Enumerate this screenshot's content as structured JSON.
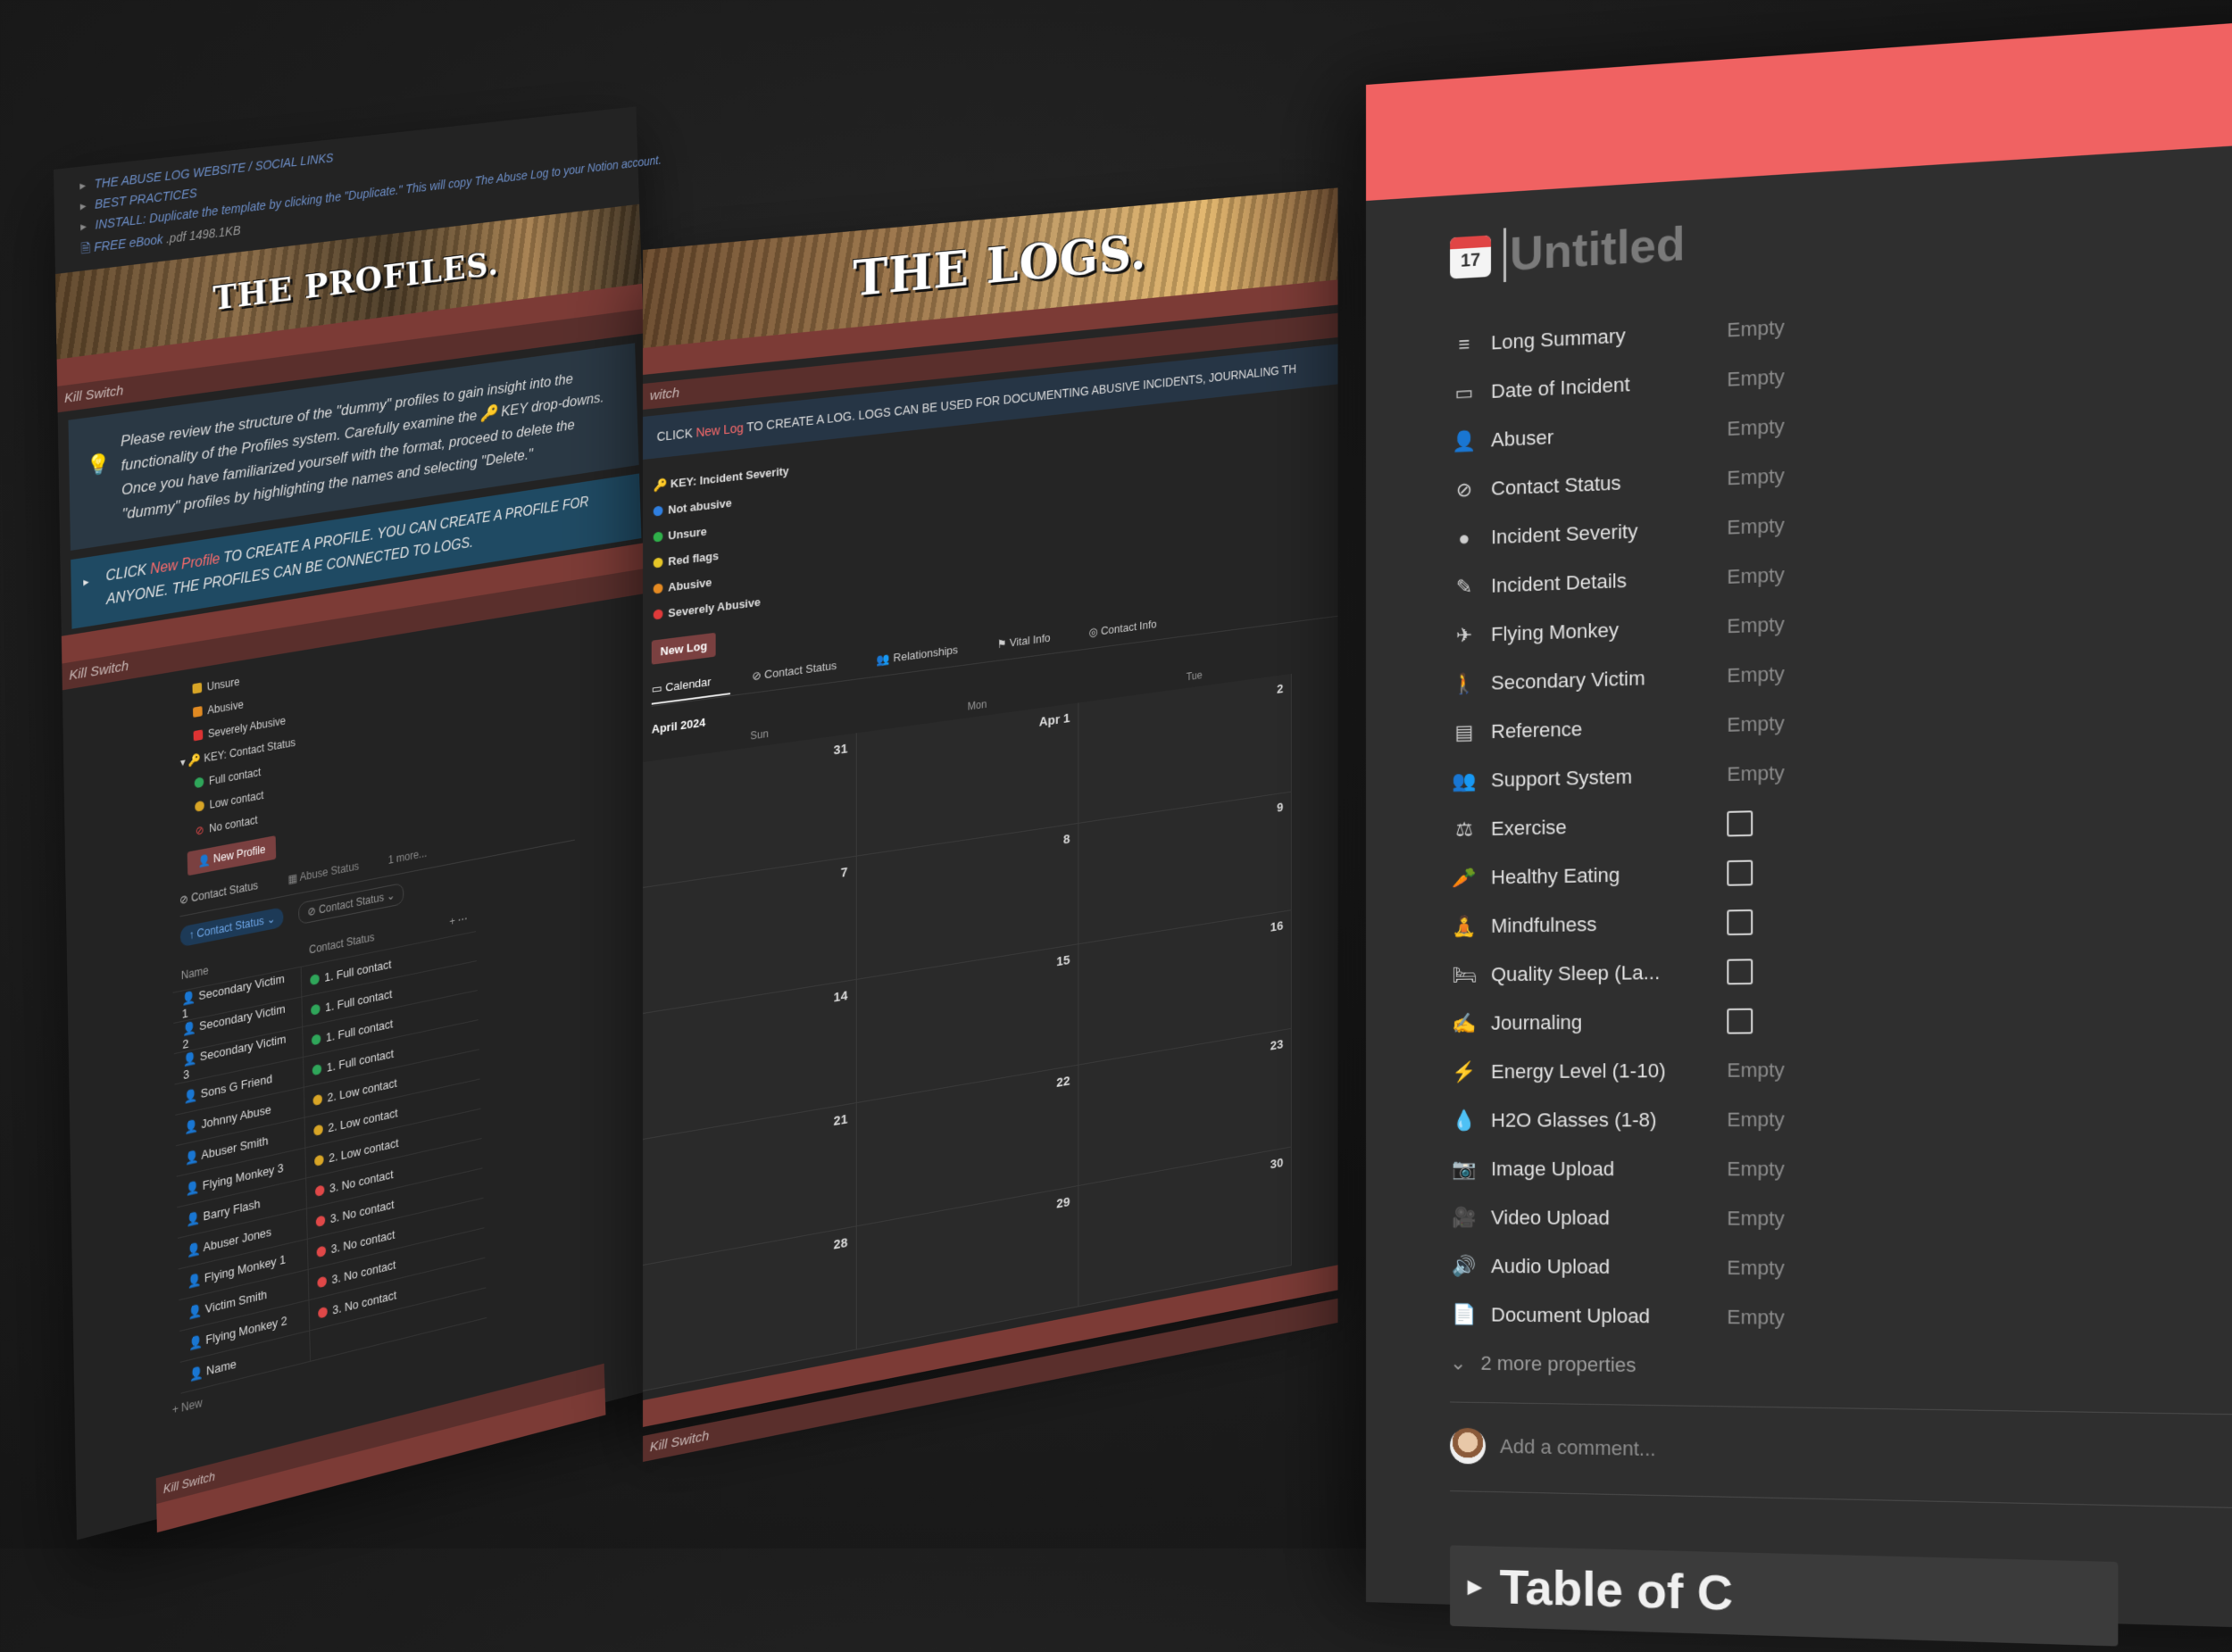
{
  "profiles": {
    "links": [
      "THE ABUSE LOG WEBSITE / SOCIAL LINKS",
      "BEST PRACTICES",
      "INSTALL: Duplicate the template by clicking the \"Duplicate.\" This will copy The Abuse Log to your Notion account."
    ],
    "ebook": "FREE eBook",
    "ebook_meta": ".pdf 1498.1KB",
    "banner_title": "THE PROFILES.",
    "kill_switch": "Kill Switch",
    "callout": "Please review the structure of the \"dummy\" profiles to gain insight into the functionality of the Profiles system. Carefully examine the 🔑 KEY drop-downs. Once you have familiarized yourself with the format, proceed to delete the \"dummy\" profiles by highlighting the names and selecting \"Delete.\"",
    "click_pre": "CLICK ",
    "click_link": "New Profile",
    "click_post": " TO CREATE A PROFILE. YOU CAN CREATE A PROFILE FOR ANYONE. THE PROFILES CAN BE CONNECTED TO LOGS.",
    "key_abuse": [
      "Unsure",
      "Abusive",
      "Severely Abusive"
    ],
    "key_contact_title": "KEY: Contact Status",
    "key_contact": [
      "Full contact",
      "Low contact",
      "No contact"
    ],
    "new_profile_btn": "New Profile",
    "tabs": [
      "Contact Status",
      "Abuse Status",
      "1 more..."
    ],
    "filter_chips": [
      "Contact Status",
      "Contact Status"
    ],
    "col_name": "Name",
    "col_status": "Contact Status",
    "rows": [
      {
        "name": "Secondary Victim 1",
        "status": "1. Full contact",
        "color": "#2fa65a"
      },
      {
        "name": "Secondary Victim 2",
        "status": "1. Full contact",
        "color": "#2fa65a"
      },
      {
        "name": "Secondary Victim 3",
        "status": "1. Full contact",
        "color": "#2fa65a"
      },
      {
        "name": "Sons G Friend",
        "status": "1. Full contact",
        "color": "#2fa65a"
      },
      {
        "name": "Johnny Abuse",
        "status": "2. Low contact",
        "color": "#d8a526"
      },
      {
        "name": "Abuser Smith",
        "status": "2. Low contact",
        "color": "#d8a526"
      },
      {
        "name": "Flying Monkey 3",
        "status": "2. Low contact",
        "color": "#d8a526"
      },
      {
        "name": "Barry Flash",
        "status": "3. No contact",
        "color": "#e04848"
      },
      {
        "name": "Abuser Jones",
        "status": "3. No contact",
        "color": "#e04848"
      },
      {
        "name": "Flying Monkey 1",
        "status": "3. No contact",
        "color": "#e04848"
      },
      {
        "name": "Victim Smith",
        "status": "3. No contact",
        "color": "#e04848"
      },
      {
        "name": "Flying Monkey 2",
        "status": "3. No contact",
        "color": "#e04848"
      },
      {
        "name": "Name",
        "status": "",
        "color": ""
      }
    ],
    "new_row": "+ New"
  },
  "logs": {
    "banner_title": "THE LOGS.",
    "switch_label": "witch",
    "click_pre": "CLICK ",
    "click_link": "New Log",
    "click_post": " TO CREATE A LOG. LOGS CAN BE USED FOR DOCUMENTING ABUSIVE INCIDENTS, JOURNALING TH",
    "key_title": "KEY: Incident Severity",
    "severity": [
      {
        "label": "Not abusive",
        "color": "#2f7fe0"
      },
      {
        "label": "Unsure",
        "color": "#2fb04a"
      },
      {
        "label": "Red flags",
        "color": "#e6c627"
      },
      {
        "label": "Abusive",
        "color": "#e58a22"
      },
      {
        "label": "Severely Abusive",
        "color": "#e03a3a"
      }
    ],
    "new_log_btn": "New Log",
    "tabs": [
      "Calendar",
      "Contact Status",
      "Relationships",
      "Vital Info",
      "Contact Info"
    ],
    "month": "April 2024",
    "days": [
      "Sun",
      "Mon",
      "Tue"
    ],
    "dates": [
      "31",
      "Apr 1",
      "2",
      "7",
      "8",
      "9",
      "14",
      "15",
      "16",
      "21",
      "22",
      "23",
      "28",
      "29",
      "30"
    ],
    "kill_switch": "Kill Switch"
  },
  "record": {
    "cover_color": "#f06262",
    "icon_day": "17",
    "title": "Untitled",
    "properties": [
      {
        "icon": "≡",
        "name": "Long Summary",
        "value": "Empty",
        "type": "text"
      },
      {
        "icon": "▭",
        "name": "Date of Incident",
        "value": "Empty",
        "type": "text"
      },
      {
        "icon": "👤",
        "name": "Abuser",
        "value": "Empty",
        "type": "text"
      },
      {
        "icon": "⊘",
        "name": "Contact Status",
        "value": "Empty",
        "type": "text"
      },
      {
        "icon": "●",
        "name": "Incident Severity",
        "value": "Empty",
        "type": "text"
      },
      {
        "icon": "✎",
        "name": "Incident Details",
        "value": "Empty",
        "type": "text"
      },
      {
        "icon": "✈",
        "name": "Flying Monkey",
        "value": "Empty",
        "type": "text"
      },
      {
        "icon": "🚶",
        "name": "Secondary Victim",
        "value": "Empty",
        "type": "text"
      },
      {
        "icon": "▤",
        "name": "Reference",
        "value": "Empty",
        "type": "text"
      },
      {
        "icon": "👥",
        "name": "Support System",
        "value": "Empty",
        "type": "text"
      },
      {
        "icon": "⚖",
        "name": "Exercise",
        "value": "",
        "type": "checkbox"
      },
      {
        "icon": "🥕",
        "name": "Healthy Eating",
        "value": "",
        "type": "checkbox"
      },
      {
        "icon": "🧘",
        "name": "Mindfulness",
        "value": "",
        "type": "checkbox"
      },
      {
        "icon": "🛏",
        "name": "Quality Sleep (La...",
        "value": "",
        "type": "checkbox"
      },
      {
        "icon": "✍",
        "name": "Journaling",
        "value": "",
        "type": "checkbox"
      },
      {
        "icon": "⚡",
        "name": "Energy Level (1-10)",
        "value": "Empty",
        "type": "text"
      },
      {
        "icon": "💧",
        "name": "H2O Glasses (1-8)",
        "value": "Empty",
        "type": "text"
      },
      {
        "icon": "📷",
        "name": "Image Upload",
        "value": "Empty",
        "type": "text"
      },
      {
        "icon": "🎥",
        "name": "Video Upload",
        "value": "Empty",
        "type": "text"
      },
      {
        "icon": "🔊",
        "name": "Audio Upload",
        "value": "Empty",
        "type": "text"
      },
      {
        "icon": "📄",
        "name": "Document Upload",
        "value": "Empty",
        "type": "text"
      }
    ],
    "more_props": "2 more properties",
    "comment_placeholder": "Add a comment...",
    "toc_title": "Table of C"
  }
}
